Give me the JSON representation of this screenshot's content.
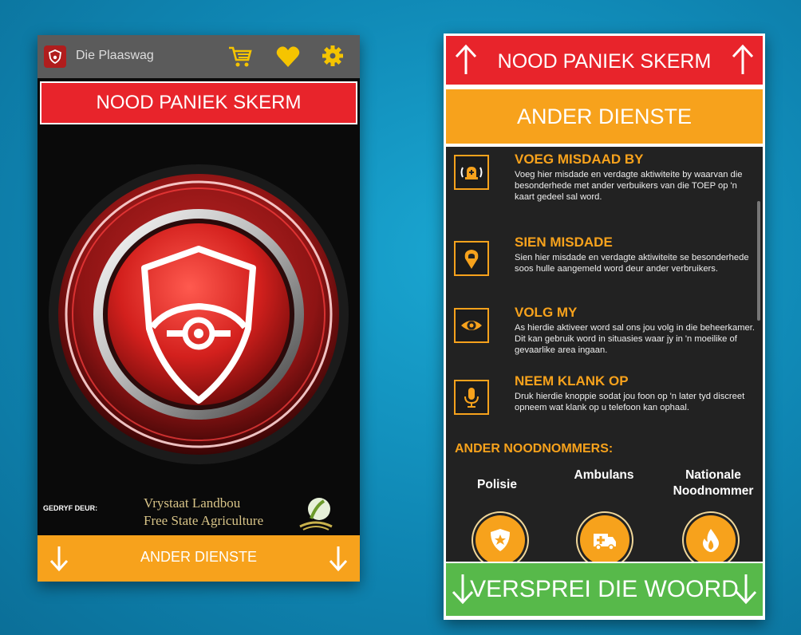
{
  "left_screen": {
    "app_title": "Die Plaaswag",
    "panic_label": "NOOD PANIEK SKERM",
    "sponsor_label": "GEDRYF DEUR:",
    "sponsor_name_line1": "Vrystaat Landbou",
    "sponsor_name_line2": "Free State Agriculture",
    "bottom_label": "ANDER DIENSTE"
  },
  "right_screen": {
    "panic_label": "NOOD PANIEK SKERM",
    "other_services_label": "ANDER DIENSTE",
    "services": [
      {
        "title": "VOEG MISDAAD BY",
        "desc": "Voeg hier misdade en verdagte aktiwiteite by waarvan die besonderhede met ander verbuikers van die TOEP op 'n kaart gedeel sal word.",
        "icon": "alarm-bell-icon"
      },
      {
        "title": "SIEN MISDADE",
        "desc": "Sien hier misdade en verdagte aktiwiteite se besonderhede soos hulle aangemeld word deur ander verbruikers.",
        "icon": "location-pin-icon"
      },
      {
        "title": "VOLG MY",
        "desc": "As hierdie aktiveer word sal ons jou volg in die beheerkamer. Dit kan gebruik word in situasies waar jy in 'n moeilike of gevaarlike area ingaan.",
        "icon": "eye-icon"
      },
      {
        "title": "NEEM KLANK OP",
        "desc": "Druk hierdie knoppie sodat jou foon op 'n later tyd discreet opneem wat klank op u telefoon kan ophaal.",
        "icon": "microphone-icon"
      }
    ],
    "emergency_title": "ANDER NOODNOMMERS:",
    "emergency": [
      {
        "label": "Polisie",
        "icon": "police-badge-icon"
      },
      {
        "label": "Ambulans",
        "icon": "ambulance-icon"
      },
      {
        "label": "Nationale Noodnommer",
        "icon": "fire-icon"
      }
    ],
    "share_label": "VERSPREI DIE WOORD"
  },
  "colors": {
    "red": "#e8242b",
    "orange": "#f7a21c",
    "green": "#57b94a",
    "yellow_icons": "#f5c400"
  }
}
